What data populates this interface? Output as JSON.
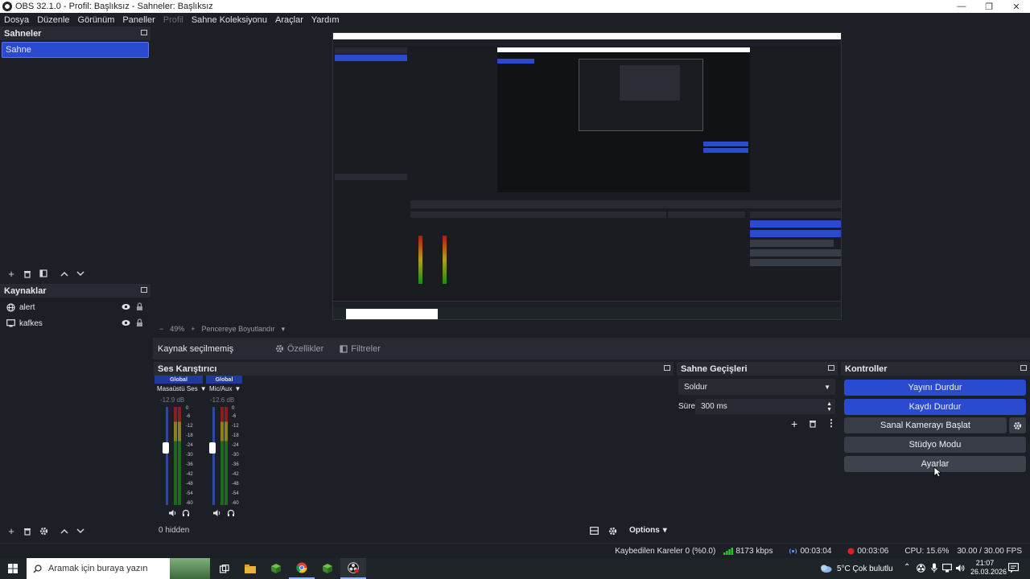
{
  "window": {
    "title": "OBS 32.1.0 - Profil: Başlıksız - Sahneler: Başlıksız",
    "minimize": "—",
    "maximize": "❐",
    "close": "✕"
  },
  "menu": [
    {
      "label": "Dosya",
      "enabled": true
    },
    {
      "label": "Düzenle",
      "enabled": true
    },
    {
      "label": "Görünüm",
      "enabled": true
    },
    {
      "label": "Paneller",
      "enabled": true
    },
    {
      "label": "Profil",
      "enabled": false
    },
    {
      "label": "Sahne Koleksiyonu",
      "enabled": true
    },
    {
      "label": "Araçlar",
      "enabled": true
    },
    {
      "label": "Yardım",
      "enabled": true
    }
  ],
  "scenes": {
    "title": "Sahneler",
    "items": [
      "Sahne"
    ]
  },
  "sources": {
    "title": "Kaynaklar",
    "items": [
      {
        "name": "alert",
        "icon": "globe-icon"
      },
      {
        "name": "kafkes",
        "icon": "monitor-icon"
      }
    ]
  },
  "zoom": {
    "percent": "49%",
    "fit_label": "Pencereye Boyutlandır"
  },
  "context": {
    "no_selection": "Kaynak seçilmemiş",
    "properties": "Özellikler",
    "filters": "Filtreler"
  },
  "mixer": {
    "title": "Ses Karıştırıcı",
    "channels": [
      {
        "badge": "Global",
        "name": "Masaüstü Ses",
        "db": "-12.9 dB",
        "level": 0.55
      },
      {
        "badge": "Global",
        "name": "Mic/Aux",
        "db": "-12.6 dB",
        "level": 0.55
      }
    ],
    "scale": [
      "0",
      "-6",
      "-12",
      "-18",
      "-24",
      "-30",
      "-36",
      "-42",
      "-48",
      "-54",
      "-60"
    ],
    "hidden": "0 hidden",
    "options": "Options"
  },
  "transitions": {
    "title": "Sahne Geçişleri",
    "type": "Soldur",
    "duration_label": "Süre",
    "duration": "300 ms"
  },
  "controls": {
    "title": "Kontroller",
    "stop_stream": "Yayını Durdur",
    "stop_record": "Kaydı Durdur",
    "virtual_cam": "Sanal Kamerayı Başlat",
    "studio_mode": "Stüdyo Modu",
    "settings": "Ayarlar"
  },
  "status": {
    "dropped": "Kaybedilen Kareler 0 (%0.0)",
    "bitrate": "8173 kbps",
    "stream_time": "00:03:04",
    "record_time": "00:03:06",
    "cpu": "CPU: 15.6%",
    "fps": "30.00 / 30.00 FPS"
  },
  "taskbar": {
    "search_placeholder": "Aramak için buraya yazın",
    "weather": "5°C  Çok bulutlu",
    "time": "21:07",
    "date": "26.03.2026"
  },
  "colors": {
    "accent": "#2a4bd0",
    "panel": "#1d1f26",
    "header": "#272a33"
  }
}
